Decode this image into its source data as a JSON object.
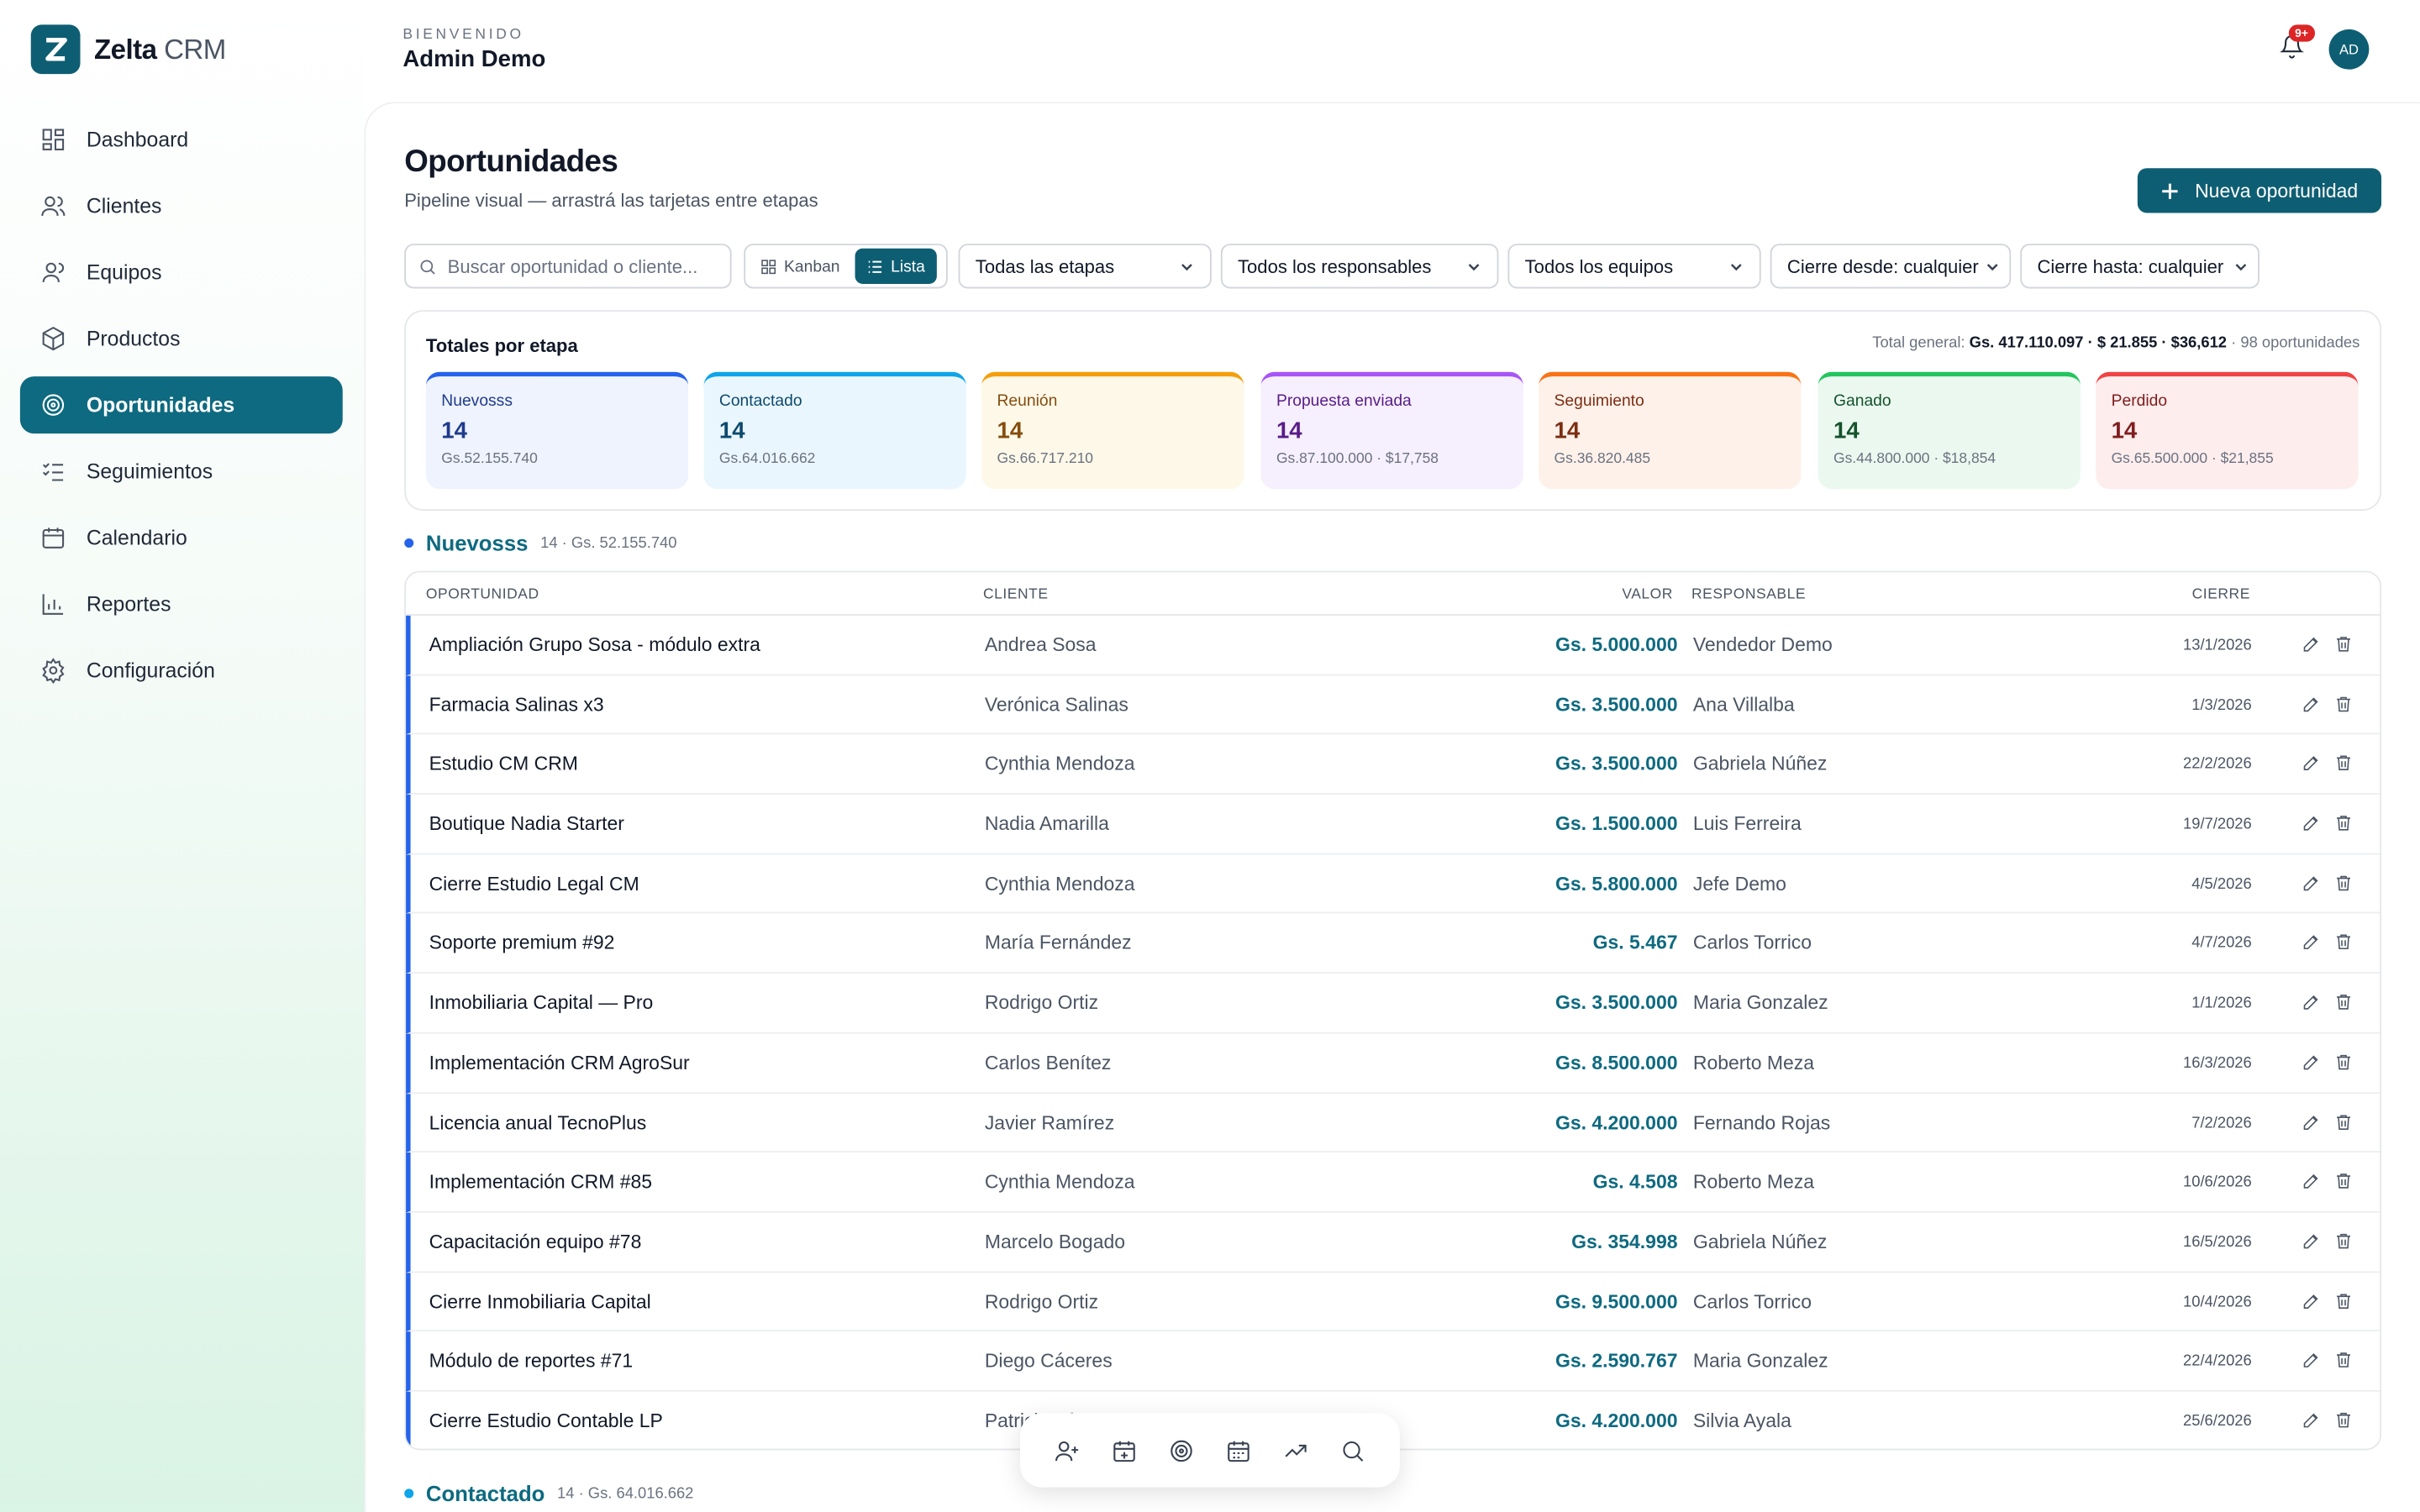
{
  "app": {
    "name_bold": "Zelta",
    "name_light": " CRM"
  },
  "header": {
    "welcome": "BIENVENIDO",
    "user_name": "Admin Demo",
    "notifications_badge": "9+",
    "avatar_initials": "AD"
  },
  "sidebar": {
    "items": [
      {
        "label": "Dashboard",
        "icon": "dashboard-icon"
      },
      {
        "label": "Clientes",
        "icon": "users-icon"
      },
      {
        "label": "Equipos",
        "icon": "team-icon"
      },
      {
        "label": "Productos",
        "icon": "box-icon"
      },
      {
        "label": "Oportunidades",
        "icon": "target-icon",
        "active": true
      },
      {
        "label": "Seguimientos",
        "icon": "checklist-icon"
      },
      {
        "label": "Calendario",
        "icon": "calendar-icon"
      },
      {
        "label": "Reportes",
        "icon": "bar-chart-icon"
      },
      {
        "label": "Configuración",
        "icon": "gear-icon"
      }
    ]
  },
  "page": {
    "title": "Oportunidades",
    "subtitle": "Pipeline visual — arrastrá las tarjetas entre etapas",
    "new_button": "Nueva oportunidad"
  },
  "filters": {
    "search_placeholder": "Buscar oportunidad o cliente...",
    "view_kanban": "Kanban",
    "view_list": "Lista",
    "stage": "Todas las etapas",
    "owner": "Todos los responsables",
    "team": "Todos los equipos",
    "close_from": "Cierre desde: cualquier",
    "close_to": "Cierre hasta: cualquier"
  },
  "totals": {
    "title": "Totales por etapa",
    "general_label": "Total general: ",
    "general_value": "Gs. 417.110.097 · $ 21.855 · $36,612",
    "general_count": " · 98 oportunidades",
    "stages": [
      {
        "name": "Nuevosss",
        "count": "14",
        "amount": "Gs.52.155.740",
        "color": "#2563eb",
        "bg": "#eef3fd",
        "text": "#1e3a8a"
      },
      {
        "name": "Contactado",
        "count": "14",
        "amount": "Gs.64.016.662",
        "color": "#0ea5e9",
        "bg": "#eaf6fd",
        "text": "#0c4a6e"
      },
      {
        "name": "Reunión",
        "count": "14",
        "amount": "Gs.66.717.210",
        "color": "#f59e0b",
        "bg": "#fdf8e8",
        "text": "#854d0e"
      },
      {
        "name": "Propuesta enviada",
        "count": "14",
        "amount": "Gs.87.100.000 · $17,758",
        "color": "#a855f7",
        "bg": "#f6effd",
        "text": "#581c87"
      },
      {
        "name": "Seguimiento",
        "count": "14",
        "amount": "Gs.36.820.485",
        "color": "#f97316",
        "bg": "#fef1ea",
        "text": "#7c2d12"
      },
      {
        "name": "Ganado",
        "count": "14",
        "amount": "Gs.44.800.000 · $18,854",
        "color": "#22c55e",
        "bg": "#ebf8ef",
        "text": "#14532d"
      },
      {
        "name": "Perdido",
        "count": "14",
        "amount": "Gs.65.500.000 · $21,855",
        "color": "#ef4444",
        "bg": "#fdeded",
        "text": "#7f1d1d"
      }
    ]
  },
  "section": {
    "title": "Nuevosss",
    "meta": "14 · Gs. 52.155.740"
  },
  "next_section": {
    "title": "Contactado",
    "meta": "14 · Gs. 64.016.662"
  },
  "table": {
    "headers": {
      "opp": "OPORTUNIDAD",
      "client": "CLIENTE",
      "value": "VALOR",
      "owner": "RESPONSABLE",
      "close": "CIERRE"
    },
    "rows": [
      {
        "opp": "Ampliación Grupo Sosa - módulo extra",
        "client": "Andrea Sosa",
        "value": "Gs. 5.000.000",
        "owner": "Vendedor Demo",
        "close": "13/1/2026"
      },
      {
        "opp": "Farmacia Salinas x3",
        "client": "Verónica Salinas",
        "value": "Gs. 3.500.000",
        "owner": "Ana Villalba",
        "close": "1/3/2026"
      },
      {
        "opp": "Estudio CM CRM",
        "client": "Cynthia Mendoza",
        "value": "Gs. 3.500.000",
        "owner": "Gabriela Núñez",
        "close": "22/2/2026"
      },
      {
        "opp": "Boutique Nadia Starter",
        "client": "Nadia Amarilla",
        "value": "Gs. 1.500.000",
        "owner": "Luis Ferreira",
        "close": "19/7/2026"
      },
      {
        "opp": "Cierre Estudio Legal CM",
        "client": "Cynthia Mendoza",
        "value": "Gs. 5.800.000",
        "owner": "Jefe Demo",
        "close": "4/5/2026"
      },
      {
        "opp": "Soporte premium #92",
        "client": "María Fernández",
        "value": "Gs. 5.467",
        "owner": "Carlos Torrico",
        "close": "4/7/2026"
      },
      {
        "opp": "Inmobiliaria Capital — Pro",
        "client": "Rodrigo Ortiz",
        "value": "Gs. 3.500.000",
        "owner": "Maria Gonzalez",
        "close": "1/1/2026"
      },
      {
        "opp": "Implementación CRM AgroSur",
        "client": "Carlos Benítez",
        "value": "Gs. 8.500.000",
        "owner": "Roberto Meza",
        "close": "16/3/2026"
      },
      {
        "opp": "Licencia anual TecnoPlus",
        "client": "Javier Ramírez",
        "value": "Gs. 4.200.000",
        "owner": "Fernando Rojas",
        "close": "7/2/2026"
      },
      {
        "opp": "Implementación CRM #85",
        "client": "Cynthia Mendoza",
        "value": "Gs. 4.508",
        "owner": "Roberto Meza",
        "close": "10/6/2026"
      },
      {
        "opp": "Capacitación equipo #78",
        "client": "Marcelo Bogado",
        "value": "Gs. 354.998",
        "owner": "Gabriela Núñez",
        "close": "16/5/2026"
      },
      {
        "opp": "Cierre Inmobiliaria Capital",
        "client": "Rodrigo Ortiz",
        "value": "Gs. 9.500.000",
        "owner": "Carlos Torrico",
        "close": "10/4/2026"
      },
      {
        "opp": "Módulo de reportes #71",
        "client": "Diego Cáceres",
        "value": "Gs. 2.590.767",
        "owner": "Maria Gonzalez",
        "close": "22/4/2026"
      },
      {
        "opp": "Cierre Estudio Contable LP",
        "client": "Patricia López",
        "value": "Gs. 4.200.000",
        "owner": "Silvia Ayala",
        "close": "25/6/2026"
      }
    ]
  },
  "dock": [
    "add-user-icon",
    "calendar-plus-icon",
    "target-icon",
    "calendar-icon",
    "trending-up-icon",
    "search-icon"
  ]
}
